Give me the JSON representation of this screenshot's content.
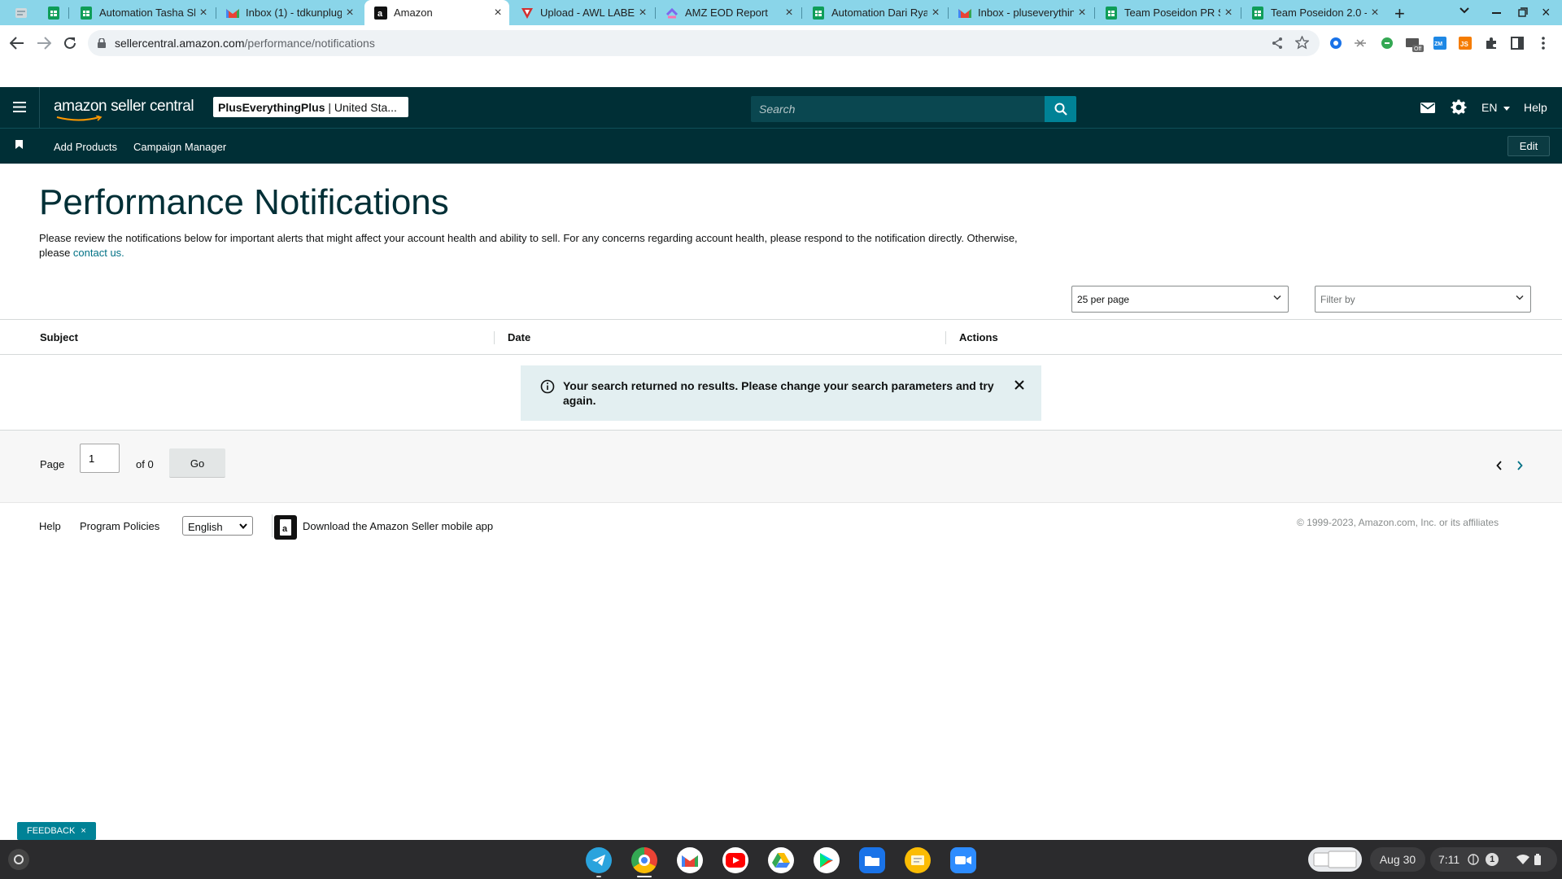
{
  "browser": {
    "tabs": [
      {
        "title": "Automation Tasha Sh",
        "icon": "sheets-icon"
      },
      {
        "title": "Inbox (1) - tdkunplug",
        "icon": "gmail-icon"
      },
      {
        "title": "Amazon",
        "icon": "amazon-icon",
        "active": true
      },
      {
        "title": "Upload - AWL LABEL",
        "icon": "red-v-icon"
      },
      {
        "title": "AMZ EOD Report",
        "icon": "clickup-icon"
      },
      {
        "title": "Automation Dari Rya",
        "icon": "sheets-icon"
      },
      {
        "title": "Inbox - pluseverything",
        "icon": "gmail-icon"
      },
      {
        "title": "Team Poseidon PR Sh",
        "icon": "sheets-icon"
      },
      {
        "title": "Team Poseidon 2.0 -",
        "icon": "sheets-icon"
      }
    ],
    "url_domain": "sellercentral.amazon.com",
    "url_path": "/performance/notifications"
  },
  "header": {
    "logo_text": "amazon seller central",
    "account_name": "PlusEverythingPlus",
    "account_region": " | United Sta...",
    "search_placeholder": "Search",
    "language": "EN",
    "help": "Help"
  },
  "subnav": {
    "items": [
      "Add Products",
      "Campaign Manager"
    ],
    "edit": "Edit"
  },
  "page": {
    "title": "Performance Notifications",
    "desc_text": "Please review the notifications below for important alerts that might affect your account health and ability to sell. For any concerns regarding account health, please respond to the notification directly. Otherwise, please ",
    "desc_link": "contact us.",
    "per_page": "25 per page",
    "filter_placeholder": "Filter by"
  },
  "table": {
    "columns": [
      "Subject",
      "Date",
      "Actions"
    ],
    "empty_message": "Your search returned no results. Please change your search parameters and try again."
  },
  "pagination": {
    "page_label": "Page",
    "page_value": "1",
    "of_label": "of 0",
    "go_label": "Go"
  },
  "footer": {
    "help": "Help",
    "program_policies": "Program Policies",
    "language": "English",
    "download_app": "Download the Amazon Seller mobile app",
    "copyright": "© 1999-2023, Amazon.com, Inc. or its affiliates"
  },
  "feedback": "FEEDBACK",
  "shelf": {
    "date": "Aug 30",
    "time": "7:11",
    "notif_count": "1"
  },
  "colors": {
    "header_bg": "#002f36",
    "search_button": "#008296",
    "tabstrip": "#8ad5e9",
    "link": "#007185"
  }
}
